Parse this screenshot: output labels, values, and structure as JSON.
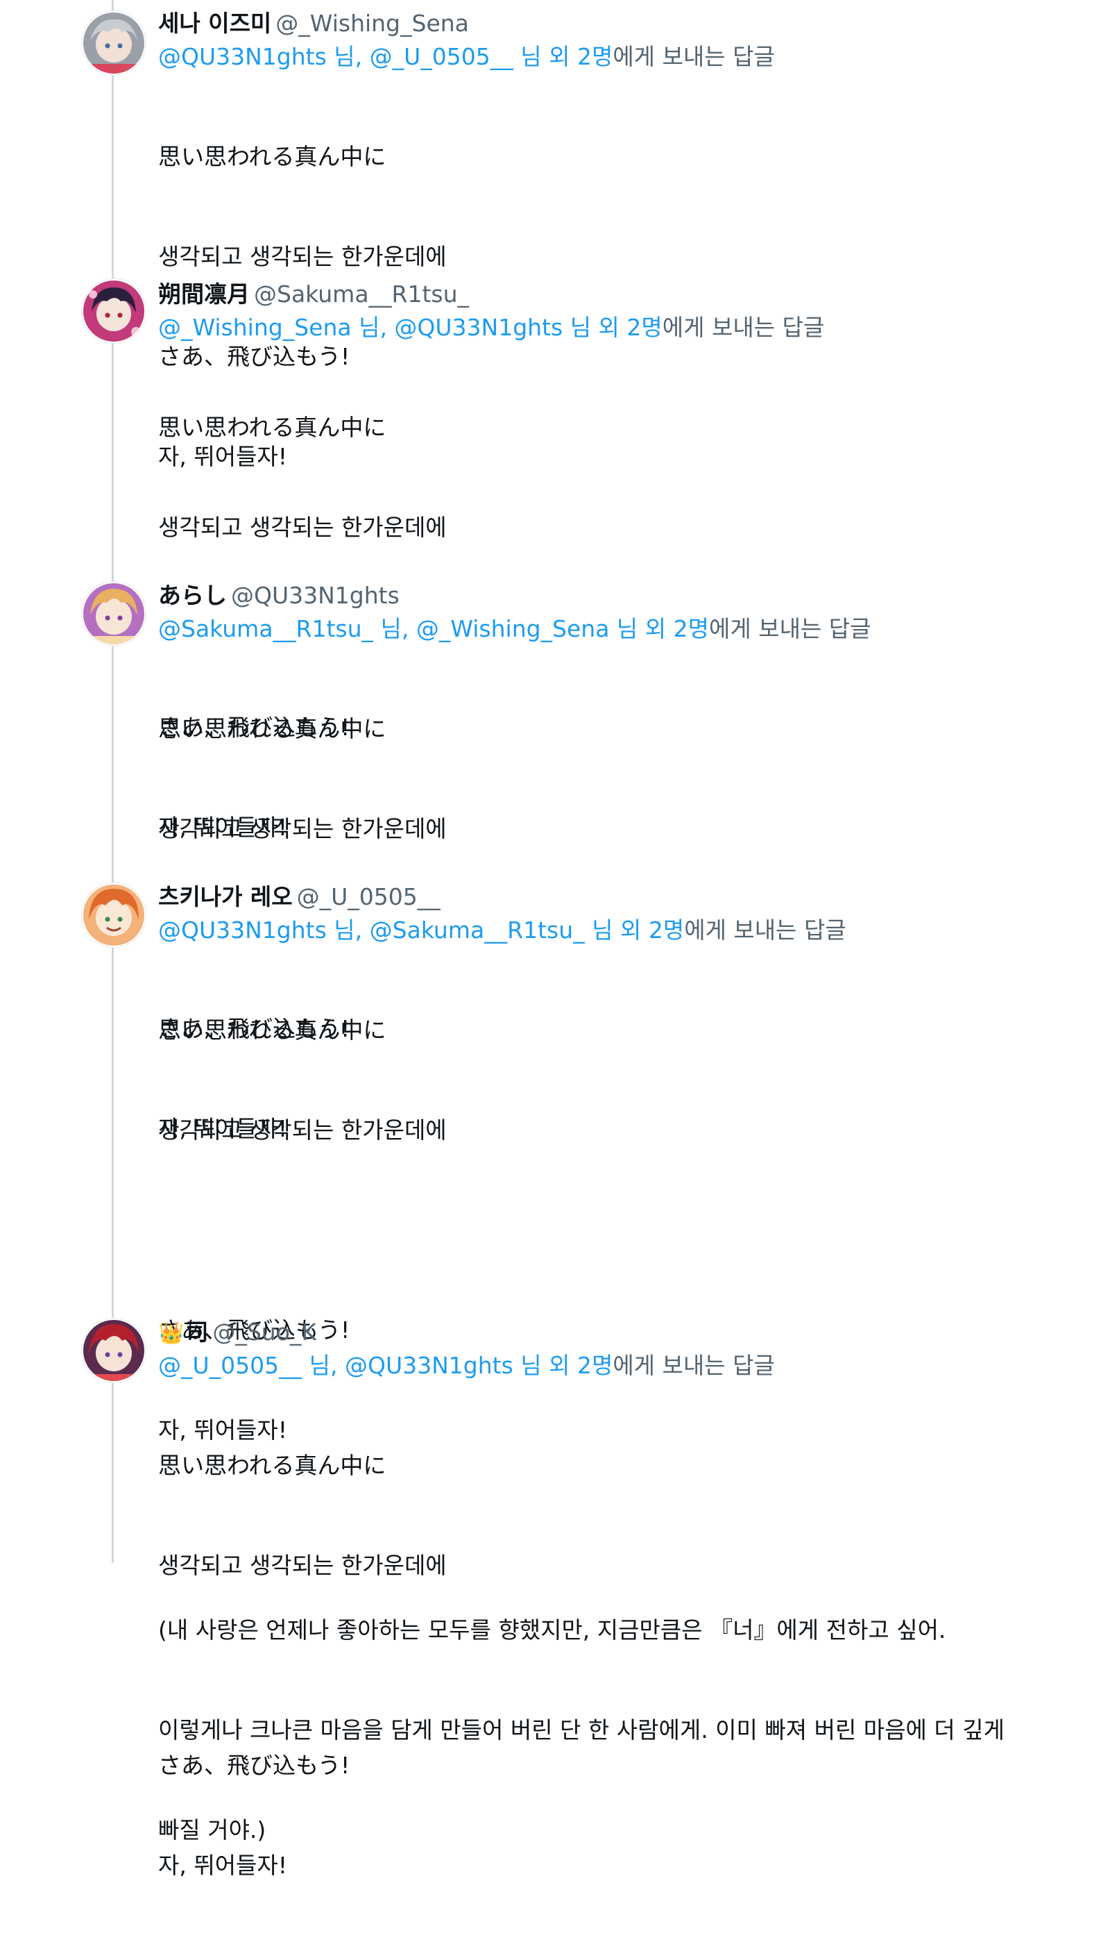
{
  "tweets": [
    {
      "display_name": "세나 이즈미",
      "handle": "@_Wishing_Sena",
      "reply_mentions": "@QU33N1ghts 님, @_U_0505__ 님 외 2명",
      "reply_suffix": "에게 보내는 답글",
      "lines": [
        "思い思われる真ん中に",
        "생각되고 생각되는 한가운데에",
        "さあ、飛び込もう!",
        "자, 뛰어들자!"
      ],
      "avatar_colors": [
        "#9aa0a8",
        "#c9ccd1",
        "#d8475e"
      ]
    },
    {
      "display_name": "朔間凛月",
      "handle": "@Sakuma__R1tsu_",
      "reply_mentions": "@_Wishing_Sena 님, @QU33N1ghts 님 외 2명",
      "reply_suffix": "에게 보내는 답글",
      "lines": [
        "思い思われる真ん中に",
        "생각되고 생각되는 한가운데에",
        "",
        "さあ、飛び込もう!",
        "자, 뛰어들자!"
      ],
      "avatar_colors": [
        "#2a1f3d",
        "#c23a7a",
        "#f1c2d4"
      ]
    },
    {
      "display_name": "あらし",
      "handle": "@QU33N1ghts",
      "reply_mentions": "@Sakuma__R1tsu_ 님, @_Wishing_Sena 님 외 2명",
      "reply_suffix": "에게 보내는 답글",
      "lines": [
        "思い思われる真ん中に",
        "생각되고 생각되는 한가운데에",
        "",
        "さあ、飛び込もう!",
        "자, 뛰어들자!"
      ],
      "avatar_colors": [
        "#e8b060",
        "#f5d9a8",
        "#b56fc0"
      ]
    },
    {
      "display_name": "츠키나가 레오",
      "handle": "@_U_0505__",
      "reply_mentions": "@QU33N1ghts 님, @Sakuma__R1tsu_ 님 외 2명",
      "reply_suffix": "에게 보내는 답글",
      "lines": [
        "思い思われる真ん中に",
        "생각되고 생각되는 한가운데에",
        "",
        "さあ、飛び込もう!",
        "자, 뛰어들자!",
        "",
        "(내 사랑은 언제나 좋아하는 모두를 향했지만, 지금만큼은 『너』에게 전하고 싶어.",
        "이렇게나 크나큰 마음을 담게 만들어 버린 단 한 사람에게. 이미 빠져 버린 마음에 더 깊게",
        "빠질 거야.)"
      ],
      "avatar_colors": [
        "#e06a2c",
        "#f3b27a",
        "#3f8a4a"
      ]
    },
    {
      "display_name": "司",
      "display_prefix": "👑",
      "handle": "@_Suo_K",
      "reply_mentions": "@_U_0505__ 님, @QU33N1ghts 님 외 2명",
      "reply_suffix": "에게 보내는 답글",
      "lines": [
        "思い思われる真ん中に",
        "생각되고 생각되는 한가운데에",
        "",
        "さあ、飛び込もう!",
        "자, 뛰어들자!"
      ],
      "avatar_colors": [
        "#b3202c",
        "#e24a4f",
        "#5a2b4f"
      ]
    }
  ]
}
